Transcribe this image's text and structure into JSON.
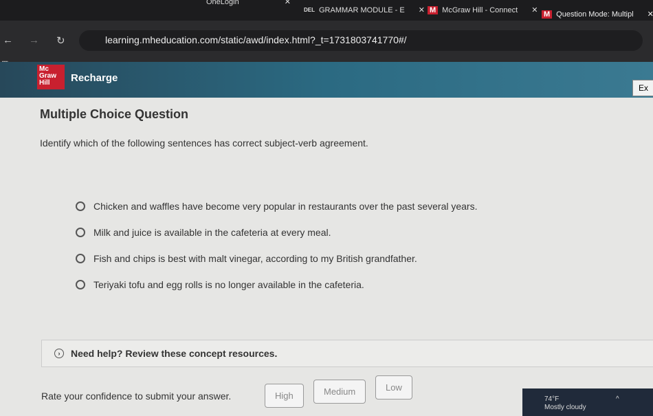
{
  "browser": {
    "tabs": [
      {
        "title": "OneLogin"
      },
      {
        "title": "GRAMMAR MODULE - E",
        "icon": "DEL"
      },
      {
        "title": "McGraw Hill - Connect",
        "icon": "M"
      },
      {
        "title": "Question Mode: Multipl",
        "icon": "M"
      }
    ],
    "url": "learning.mheducation.com/static/awd/index.html?_t=1731803741770#/"
  },
  "header": {
    "logo": "Mc Graw Hill",
    "app": "Recharge",
    "exit": "Ex"
  },
  "question": {
    "type": "Multiple Choice Question",
    "prompt": "Identify which of the following sentences has correct subject-verb agreement.",
    "options": [
      "Chicken and waffles have become very popular in restaurants over the past several years.",
      "Milk and juice is available in the cafeteria at every meal.",
      "Fish and chips is best with malt vinegar, according to my British grandfather.",
      "Teriyaki tofu and egg rolls is no longer available in the cafeteria."
    ]
  },
  "help": "Need help? Review these concept resources.",
  "confidence": {
    "prompt": "Rate your confidence to submit your answer.",
    "high": "High",
    "medium": "Medium",
    "low": "Low"
  },
  "taskbar": {
    "temp": "74°F",
    "weather": "Mostly cloudy"
  }
}
